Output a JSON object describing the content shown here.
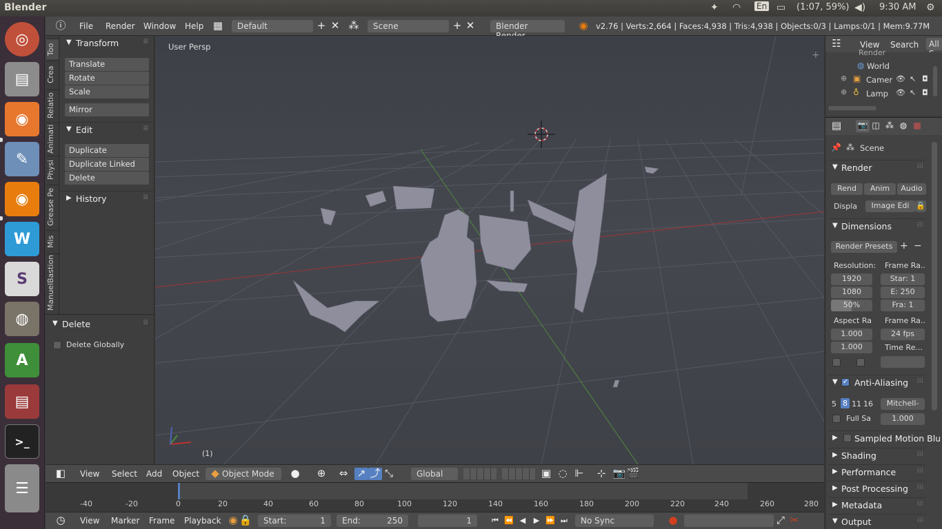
{
  "topbar": {
    "app_name": "Blender",
    "keyboard": "En",
    "battery": "(1:07, 59%)",
    "clock": "9:30 AM"
  },
  "header": {
    "menus": [
      "File",
      "Render",
      "Window",
      "Help"
    ],
    "layout": "Default",
    "scene": "Scene",
    "engine": "Blender Render",
    "stats": "v2.76 | Verts:2,664 | Faces:4,938 | Tris:4,938 | Objects:0/3 | Lamps:0/1 | Mem:9.77M"
  },
  "tool_tabs": [
    "Too",
    "Crea",
    "Relatio",
    "Animati",
    "Physi",
    "Grease Pe",
    "Mis",
    "ManuelBastion"
  ],
  "toolshelf": {
    "transform": {
      "title": "Transform",
      "buttons": [
        "Translate",
        "Rotate",
        "Scale"
      ],
      "mirror": "Mirror"
    },
    "edit": {
      "title": "Edit",
      "buttons": [
        "Duplicate",
        "Duplicate Linked",
        "Delete"
      ]
    },
    "history": {
      "title": "History"
    }
  },
  "operator": {
    "title": "Delete",
    "option": "Delete Globally"
  },
  "viewport": {
    "label": "User Persp",
    "frame": "(1)"
  },
  "view_footer": {
    "menus": [
      "View",
      "Select",
      "Add",
      "Object"
    ],
    "mode": "Object Mode",
    "orientation": "Global"
  },
  "timeline": {
    "ticks": [
      "-40",
      "-20",
      "0",
      "20",
      "40",
      "60",
      "80",
      "100",
      "120",
      "140",
      "160",
      "180",
      "200",
      "220",
      "240",
      "260",
      "280"
    ]
  },
  "time_footer": {
    "menus": [
      "View",
      "Marker",
      "Frame",
      "Playback"
    ],
    "start_label": "Start:",
    "start": "1",
    "end_label": "End:",
    "end": "250",
    "current": "1",
    "sync": "No Sync"
  },
  "outliner": {
    "menus": [
      "View",
      "Search"
    ],
    "filter": "All S",
    "cut_item": "Render",
    "items": [
      "World",
      "Camer",
      "Lamp"
    ]
  },
  "properties": {
    "breadcrumb": "Scene",
    "render": {
      "title": "Render",
      "buttons": [
        "Rend",
        "Anim",
        "Audio"
      ],
      "display_label": "Displa",
      "display_value": "Image Edi"
    },
    "dimensions": {
      "title": "Dimensions",
      "presets": "Render Presets",
      "resolution_label": "Resolution:",
      "res_x": "1920",
      "res_y": "1080",
      "res_pct": "50%",
      "frame_range_label": "Frame Ra...",
      "start": "Star: 1",
      "end": "E: 250",
      "step": "Fra: 1",
      "aspect_label": "Aspect Ra",
      "aspect_x": "1.000",
      "aspect_y": "1.000",
      "frame_rate_label": "Frame Ra...",
      "fps": "24 fps",
      "time_remap_label": "Time Re..."
    },
    "aa": {
      "title": "Anti-Aliasing",
      "samples": [
        "5",
        "8",
        "11",
        "16"
      ],
      "filter": "Mitchell-",
      "full_sample": "Full Sa",
      "size": "1.000"
    },
    "collapsed": [
      "Sampled Motion Blu",
      "Shading",
      "Performance",
      "Post Processing",
      "Metadata",
      "Output"
    ]
  },
  "colors": {
    "accent": "#5680c2",
    "x_axis": "#9b3535",
    "y_axis": "#4d8a3c",
    "mesh": "#8e8e9c"
  }
}
